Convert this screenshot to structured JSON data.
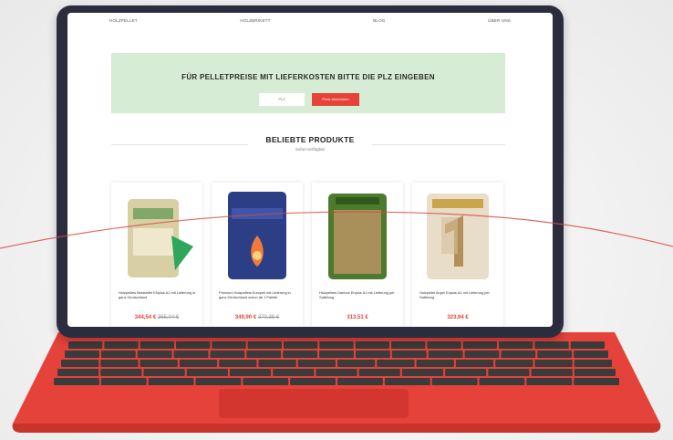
{
  "nav": [
    "HOLZPELLET",
    "HOLZBRIKETT",
    "BLOG",
    "ÜBER UNS"
  ],
  "plz": {
    "title": "FÜR PELLETPREISE MIT LIEFERKOSTEN BITTE DIE PLZ EINGEBEN",
    "input_placeholder": "PLZ",
    "button_label": "Preis berechnen"
  },
  "section": {
    "title": "BELIEBTE PRODUKTE",
    "subtitle": "Sofort verfügbar"
  },
  "products": [
    {
      "name": "Holzpellets Bestseller ENplus A1 mit Lieferung in ganz Deutschland",
      "price": "344,54 €",
      "old_price": "365,04 €",
      "bag_color": "#d9cfa4",
      "icon": "pellet-bag-icon"
    },
    {
      "name": "Premium Holzpellets Europell mit Lieferung in ganz Deutschland schon ab 1 Palette",
      "price": "349,90 €",
      "old_price": "370,38 €",
      "bag_color": "#2c3e86",
      "icon": "pellet-bag-icon"
    },
    {
      "name": "Holzpellets Danhoe Enplus A1 mit Lieferung per Sattelzug",
      "price": "313,51 €",
      "old_price": "",
      "bag_color": "#4d7a2e",
      "icon": "pellet-bag-icon"
    },
    {
      "name": "Holzpellet Anpel Enplus A1 mit Lieferung per Sattelzug",
      "price": "323,94 €",
      "old_price": "",
      "bag_color": "#e8ddc8",
      "icon": "pellet-bag-icon"
    }
  ],
  "colors": {
    "accent": "#e5423a",
    "laptop_body": "#e5423a",
    "bezel": "#2b2c3d",
    "plz_band": "#d6ecd4"
  }
}
